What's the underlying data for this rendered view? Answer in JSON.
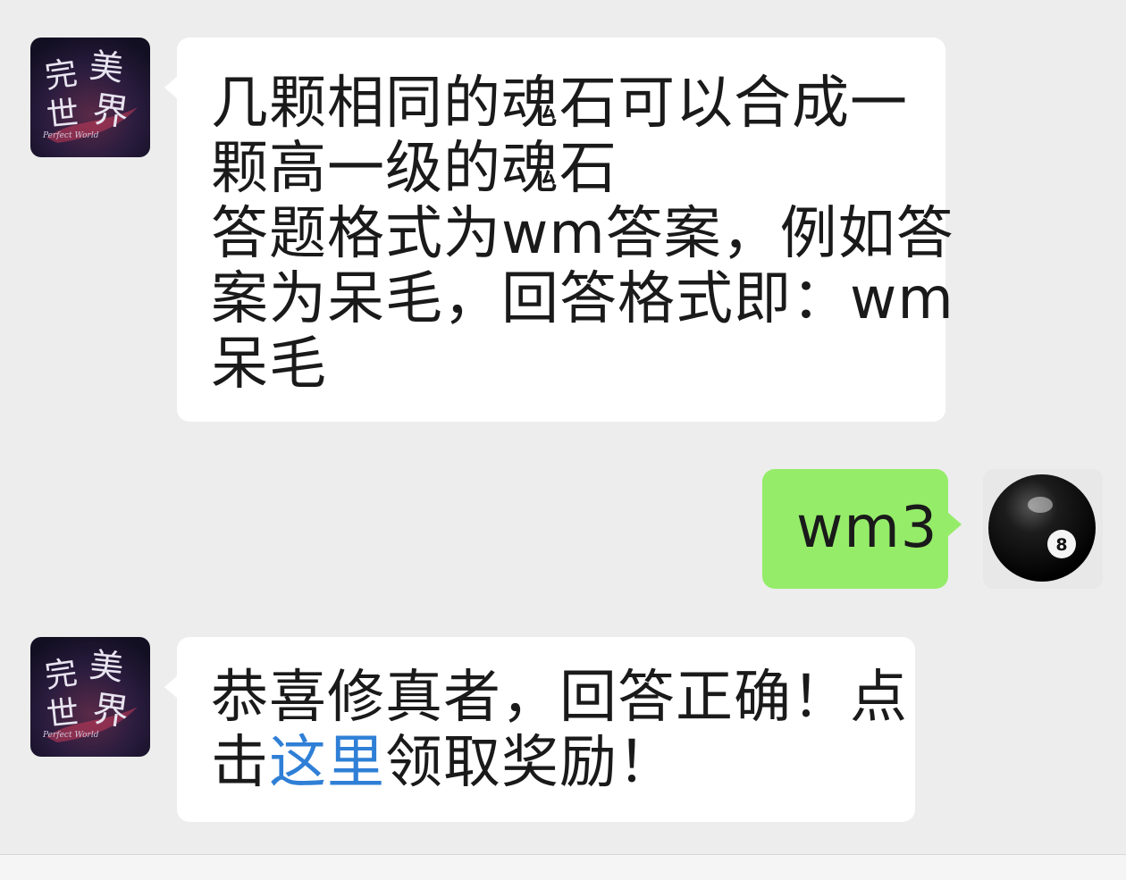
{
  "messages": [
    {
      "sender": "official-account",
      "direction": "incoming",
      "avatar": {
        "title_chars": [
          "完",
          "美",
          "世",
          "界"
        ],
        "subtitle": "Perfect World",
        "bg": "#1a1530",
        "accent": "#c83a5a"
      },
      "lines": [
        "几颗相同的魂石可以合成一",
        "颗高一级的魂石",
        "答题格式为wm答案，例如答",
        "案为呆毛，回答格式即：wm",
        "呆毛"
      ]
    },
    {
      "sender": "me",
      "direction": "outgoing",
      "avatar": {
        "icon": "eight-ball-icon",
        "ball_number": "8"
      },
      "text": "wm3"
    },
    {
      "sender": "official-account",
      "direction": "incoming",
      "avatar": {
        "title_chars": [
          "完",
          "美",
          "世",
          "界"
        ],
        "subtitle": "Perfect World",
        "bg": "#1a1530",
        "accent": "#c83a5a"
      },
      "line1": "恭喜修真者，回答正确！点",
      "line2_prefix": "击",
      "link_text": "这里",
      "line2_suffix": "领取奖励！"
    }
  ],
  "colors": {
    "background": "#ededed",
    "incoming_bubble": "#ffffff",
    "outgoing_bubble": "#95ec69",
    "link": "#2f7fd6",
    "text": "#1a1a1a"
  }
}
